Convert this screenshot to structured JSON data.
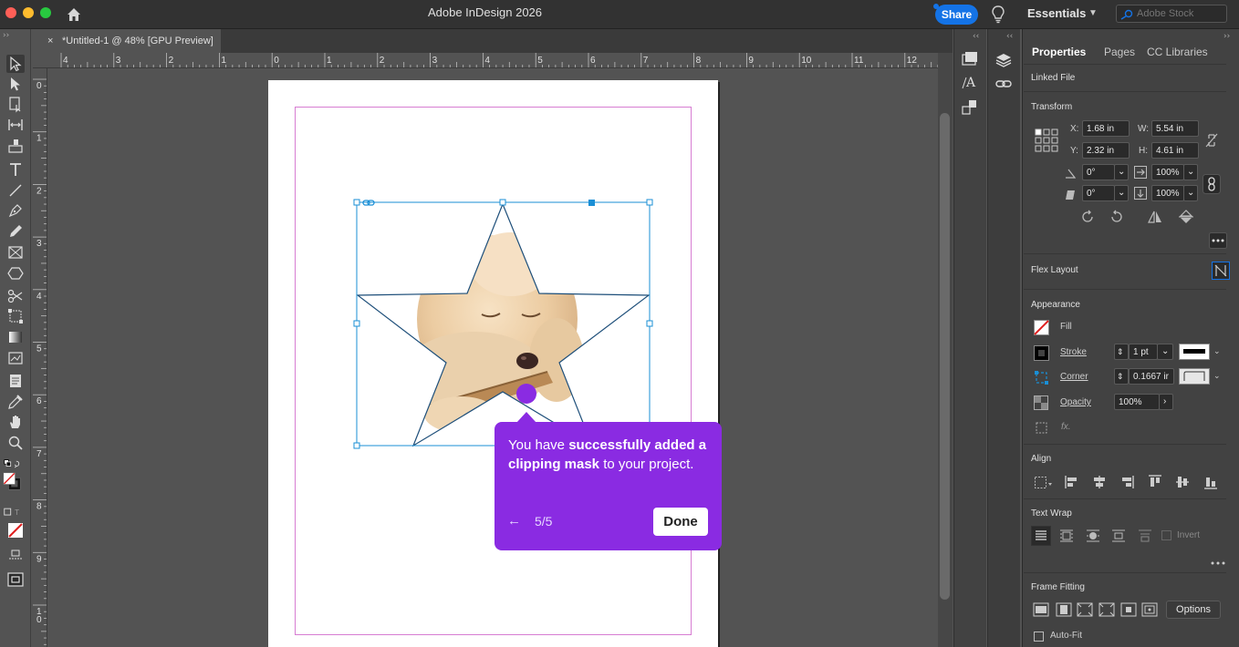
{
  "window": {
    "title": "Adobe InDesign 2026"
  },
  "header": {
    "share_label": "Share",
    "workspace_label": "Essentials",
    "search_placeholder": "Adobe Stock"
  },
  "document": {
    "tab_label": "*Untitled-1 @ 48% [GPU Preview]",
    "tab_close": "×"
  },
  "rulers": {
    "top_ticks": [
      "4",
      "3",
      "2",
      "1",
      "0",
      "1",
      "2",
      "3",
      "4",
      "5",
      "6",
      "7",
      "8",
      "9",
      "10",
      "11",
      "12"
    ],
    "left_ticks": [
      "0",
      "1",
      "2",
      "3",
      "4",
      "5",
      "6",
      "7",
      "8",
      "9",
      "1",
      "0"
    ]
  },
  "properties": {
    "tabs": [
      "Properties",
      "Pages",
      "CC Libraries"
    ],
    "linked_file": "Linked File",
    "transform": {
      "title": "Transform",
      "x_label": "X:",
      "x_value": "1.68 in",
      "w_label": "W:",
      "w_value": "5.54 in",
      "y_label": "Y:",
      "y_value": "2.32 in",
      "h_label": "H:",
      "h_value": "4.61 in",
      "rotate_value": "0°",
      "shear_value": "0°",
      "scale_x": "100%",
      "scale_y": "100%"
    },
    "flex_layout": "Flex Layout",
    "appearance": {
      "title": "Appearance",
      "fill": "Fill",
      "stroke": "Stroke",
      "stroke_weight": "1 pt",
      "corner": "Corner",
      "corner_value": "0.1667 ir",
      "opacity": "Opacity",
      "opacity_value": "100%",
      "fx": "fx."
    },
    "align": "Align",
    "text_wrap": {
      "title": "Text Wrap",
      "invert": "Invert"
    },
    "frame_fitting": {
      "title": "Frame Fitting",
      "options": "Options",
      "auto_fit": "Auto-Fit"
    }
  },
  "tooltip": {
    "text_1": "You have ",
    "text_bold": "successfully added a clipping mask",
    "text_2": " to your project.",
    "back": "←",
    "step": "5/5",
    "done": "Done"
  },
  "colors": {
    "accent": "#8a2be2",
    "share": "#1473e6",
    "margin_guide": "#d77dd2",
    "selection": "#1a8fd6"
  }
}
